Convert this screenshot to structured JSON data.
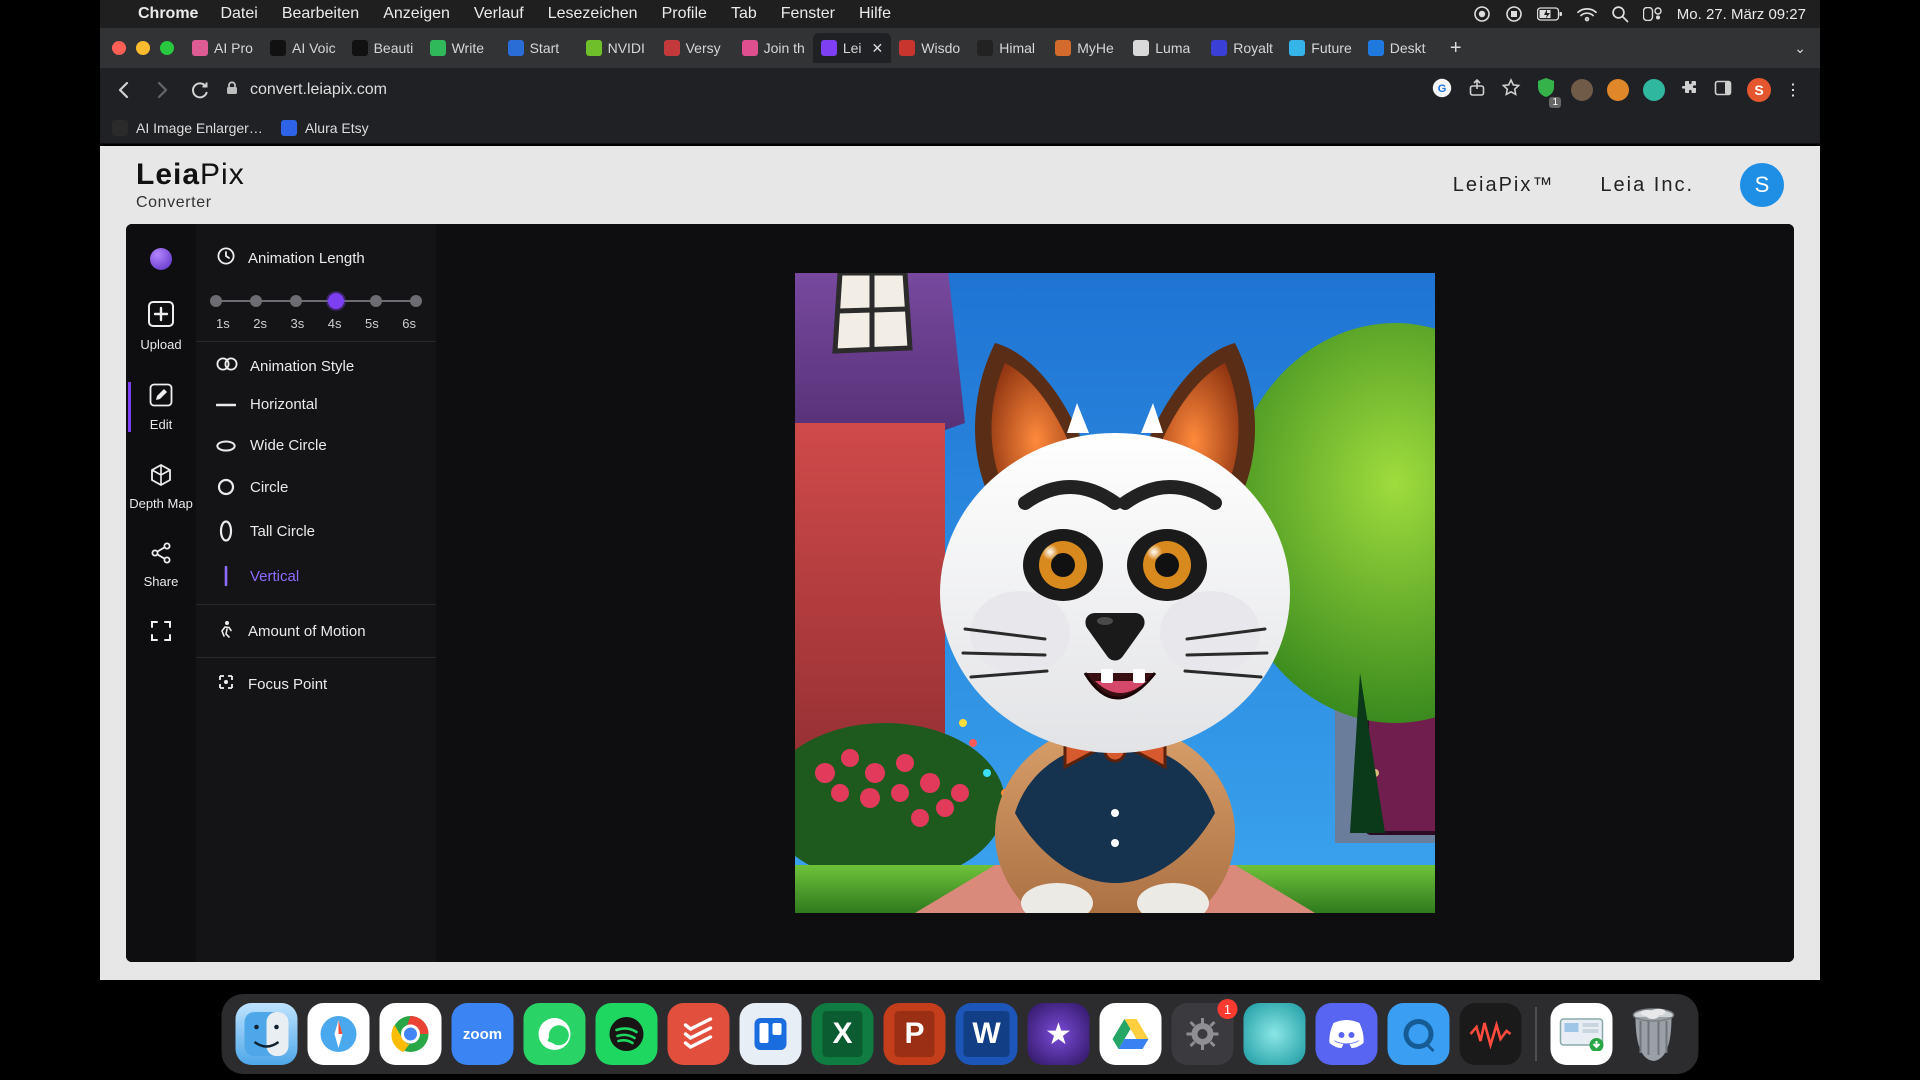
{
  "macos": {
    "app": "Chrome",
    "menus": [
      "Datei",
      "Bearbeiten",
      "Anzeigen",
      "Verlauf",
      "Lesezeichen",
      "Profile",
      "Tab",
      "Fenster",
      "Hilfe"
    ],
    "clock": "Mo. 27. März  09:27"
  },
  "browser": {
    "tabs": [
      {
        "label": "AI Pro",
        "fav": "#dd5c93"
      },
      {
        "label": "AI Voic",
        "fav": "#111111"
      },
      {
        "label": "Beauti",
        "fav": "#111111"
      },
      {
        "label": "Write",
        "fav": "#2fb95a"
      },
      {
        "label": "Start",
        "fav": "#2b6dd6"
      },
      {
        "label": "NVIDI",
        "fav": "#6fbf2a"
      },
      {
        "label": "Versy",
        "fav": "#c23a3a"
      },
      {
        "label": "Join th",
        "fav": "#de4f8f"
      },
      {
        "label": "Lei",
        "fav": "#7e3ff2",
        "active": true
      },
      {
        "label": "Wisdo",
        "fav": "#c7352e"
      },
      {
        "label": "Himal",
        "fav": "#222222"
      },
      {
        "label": "MyHe",
        "fav": "#d36a2e"
      },
      {
        "label": "Luma",
        "fav": "#d9d9d9"
      },
      {
        "label": "Royalt",
        "fav": "#3a3fd6"
      },
      {
        "label": "Future",
        "fav": "#35b4e8"
      },
      {
        "label": "Deskt",
        "fav": "#1f7ae0"
      }
    ],
    "url": "convert.leiapix.com",
    "ext_adblock_badge": "1",
    "profile_letter": "S",
    "bookmarks": [
      {
        "label": "AI Image Enlarger…",
        "fav": "#2a2a2a"
      },
      {
        "label": "Alura Etsy",
        "fav": "#2e63e7"
      }
    ]
  },
  "app": {
    "brand_bold": "Leia",
    "brand_thin": "Pix",
    "brand_sub": "Converter",
    "nav": {
      "leiapix": "LeiaPix™",
      "leiainc": "Leia Inc."
    },
    "avatar_letter": "S",
    "sidebar": {
      "upload": "Upload",
      "edit": "Edit",
      "depth": "Depth Map",
      "share": "Share"
    },
    "panel": {
      "animation_length": "Animation Length",
      "ticks": [
        "1s",
        "2s",
        "3s",
        "4s",
        "5s",
        "6s"
      ],
      "selected_tick_index": 3,
      "animation_style": "Animation Style",
      "styles": [
        {
          "key": "horizontal",
          "label": "Horizontal"
        },
        {
          "key": "wide_circle",
          "label": "Wide Circle"
        },
        {
          "key": "circle",
          "label": "Circle"
        },
        {
          "key": "tall_circle",
          "label": "Tall Circle"
        },
        {
          "key": "vertical",
          "label": "Vertical"
        }
      ],
      "selected_style": "vertical",
      "amount_of_motion": "Amount of Motion",
      "focus_point": "Focus Point"
    }
  },
  "dock": {
    "settings_badge": "1"
  }
}
